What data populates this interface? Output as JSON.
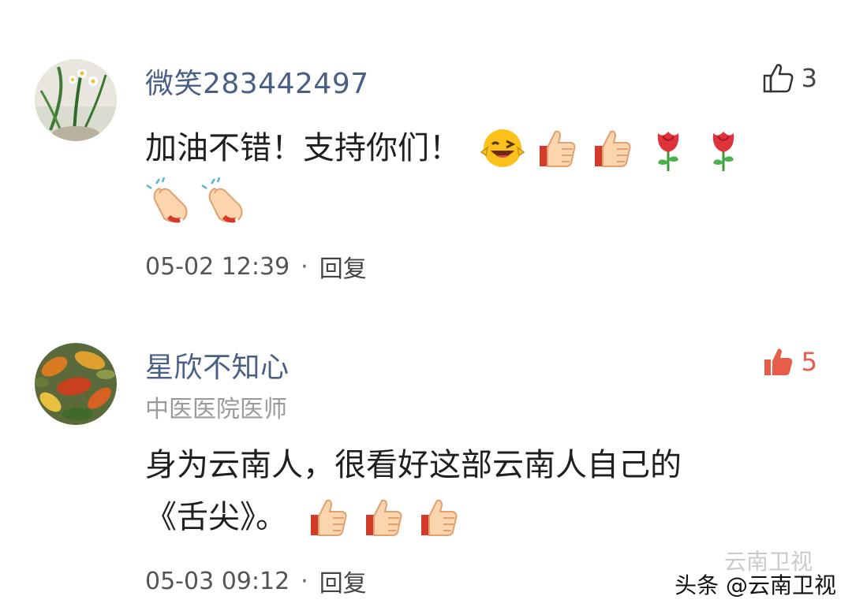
{
  "comments": [
    {
      "username": "微笑283442497",
      "likes": "3",
      "liked": false,
      "avatar": "narcissus-flower-avatar",
      "lines": [
        {
          "text": "加油不错！支持你们！",
          "emojis": [
            "grin-wink-emoji",
            "thumbs-up-emoji",
            "thumbs-up-emoji",
            "rose-emoji",
            "rose-emoji"
          ]
        },
        {
          "text": "",
          "emojis": [
            "clap-emoji",
            "clap-emoji"
          ]
        }
      ],
      "time": "05-02 12:39",
      "reply_label": "回复"
    },
    {
      "username": "星欣不知心",
      "user_title": "中医医院医师",
      "likes": "5",
      "liked": true,
      "avatar": "autumn-leaves-avatar",
      "lines": [
        {
          "text": "身为云南人，很看好这部云南人自己的",
          "emojis": []
        },
        {
          "text": "《舌尖》。",
          "emojis": [
            "thumbs-up-emoji",
            "thumbs-up-emoji",
            "thumbs-up-emoji"
          ]
        }
      ],
      "time": "05-03 09:12",
      "reply_label": "回复"
    }
  ],
  "separator": "·",
  "watermark": {
    "faint": "云南卫视",
    "main": "头条 @云南卫视"
  },
  "colors": {
    "username": "#4a5f86",
    "liked": "#e85c4a",
    "meta": "#555555"
  }
}
